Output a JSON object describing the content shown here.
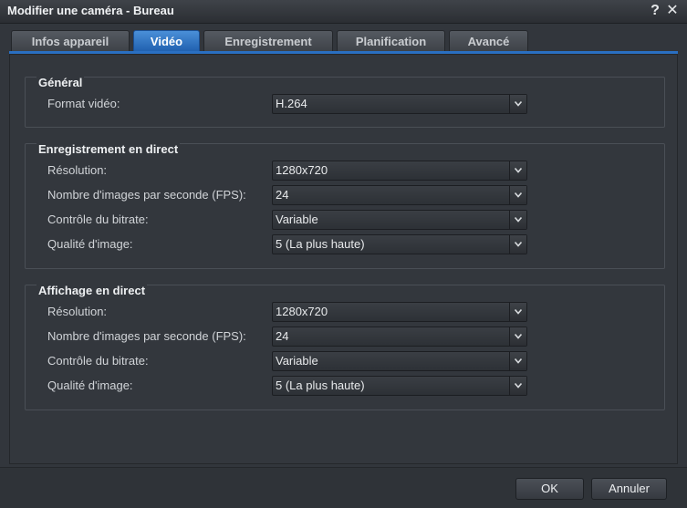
{
  "window": {
    "title": "Modifier une caméra - Bureau",
    "help_label": "?",
    "close_label": "✕"
  },
  "tabs": [
    {
      "label": "Infos appareil",
      "active": false
    },
    {
      "label": "Vidéo",
      "active": true
    },
    {
      "label": "Enregistrement",
      "active": false
    },
    {
      "label": "Planification",
      "active": false
    },
    {
      "label": "Avancé",
      "active": false
    }
  ],
  "general": {
    "title": "Général",
    "format_label": "Format vidéo:",
    "format_value": "H.264"
  },
  "recording": {
    "title": "Enregistrement en direct",
    "rows": [
      {
        "label": "Résolution:",
        "value": "1280x720"
      },
      {
        "label": "Nombre d'images par seconde (FPS):",
        "value": "24"
      },
      {
        "label": "Contrôle du bitrate:",
        "value": "Variable"
      },
      {
        "label": "Qualité d'image:",
        "value": "5 (La plus haute)"
      }
    ]
  },
  "live": {
    "title": "Affichage en direct",
    "rows": [
      {
        "label": "Résolution:",
        "value": "1280x720"
      },
      {
        "label": "Nombre d'images par seconde (FPS):",
        "value": "24"
      },
      {
        "label": "Contrôle du bitrate:",
        "value": "Variable"
      },
      {
        "label": "Qualité d'image:",
        "value": "5 (La plus haute)"
      }
    ]
  },
  "buttons": {
    "ok": "OK",
    "cancel": "Annuler"
  },
  "icons": {
    "dropdown": "chevron-down-icon",
    "help": "help-icon",
    "close": "close-icon"
  },
  "colors": {
    "accent": "#2a6fc2",
    "background": "#32363c"
  }
}
